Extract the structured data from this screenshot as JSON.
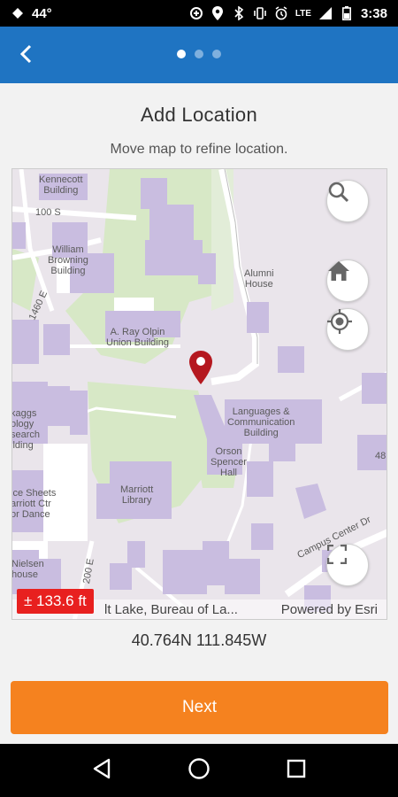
{
  "status_bar": {
    "temperature": "44°",
    "network": "LTE",
    "time": "3:38",
    "icons": [
      "notification-icon",
      "data-saver-icon",
      "location-icon",
      "bluetooth-icon",
      "vibrate-icon",
      "alarm-icon",
      "signal-icon",
      "battery-icon"
    ]
  },
  "app_bar": {
    "back_icon": "chevron-left-icon",
    "page_dots": 3,
    "active_page": 1
  },
  "main": {
    "title": "Add Location",
    "subtitle": "Move map to refine location."
  },
  "map": {
    "labels": {
      "kennecott": "Kennecott\nBuilding",
      "street_100s": "100 S",
      "william_browning": "William\nBrowning\nBuilding",
      "street_1460e": "1460 E",
      "alumni_house": "Alumni\nHouse",
      "olpin": "A. Ray Olpin\nUnion Building",
      "skaggs": "kaggs\nology\nsearch\nilding",
      "languages": "Languages &\nCommunication\nBuilding",
      "orson_spencer": "Orson\nSpencer\nHall",
      "street_48": "48",
      "sheets": "ice Sheets\narriott Ctr\nor Dance",
      "marriott": "Marriott\nLibrary",
      "campus_center": "Campus Center Dr",
      "nielsen": "Nielsen\nhouse",
      "street_200e": "200 E"
    },
    "accuracy": "± 133.6 ft",
    "attribution_left": "lt Lake, Bureau of La...",
    "attribution_right": "Powered by Esri",
    "buttons": {
      "search": "search-icon",
      "home": "home-icon",
      "locate": "locate-icon",
      "fullscreen": "fullscreen-icon"
    }
  },
  "coordinates": "40.764N 111.845W",
  "next_button": "Next",
  "nav_bar": {
    "back": "back-triangle-icon",
    "home": "home-circle-icon",
    "recents": "recents-square-icon"
  },
  "colors": {
    "app_bar": "#1f74c2",
    "accent_orange": "#f5821f",
    "accuracy_red": "#e8201f",
    "pin_red": "#b5181f",
    "building_purple": "#c9bde0",
    "green_space": "#d7e8c6"
  }
}
